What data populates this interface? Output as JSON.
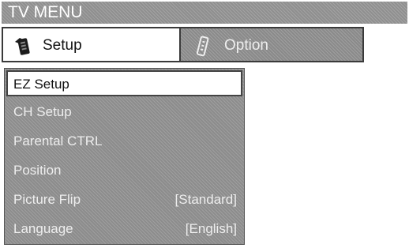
{
  "header": {
    "title": "TV MENU"
  },
  "tabs": [
    {
      "label": "Setup",
      "icon": "remote-control-icon",
      "active": true
    },
    {
      "label": "Option",
      "icon": "remote-control-icon",
      "active": false
    }
  ],
  "menu": {
    "items": [
      {
        "label": "EZ Setup",
        "value": "",
        "selected": true
      },
      {
        "label": "CH Setup",
        "value": ""
      },
      {
        "label": "Parental CTRL",
        "value": ""
      },
      {
        "label": "Position",
        "value": ""
      },
      {
        "label": "Picture Flip",
        "value": "[Standard]"
      },
      {
        "label": "Language",
        "value": "[English]"
      }
    ]
  },
  "colors": {
    "panel_gray": "#8c8c8c",
    "selected_bg": "#ffffff",
    "text_light": "#eeeeee"
  }
}
